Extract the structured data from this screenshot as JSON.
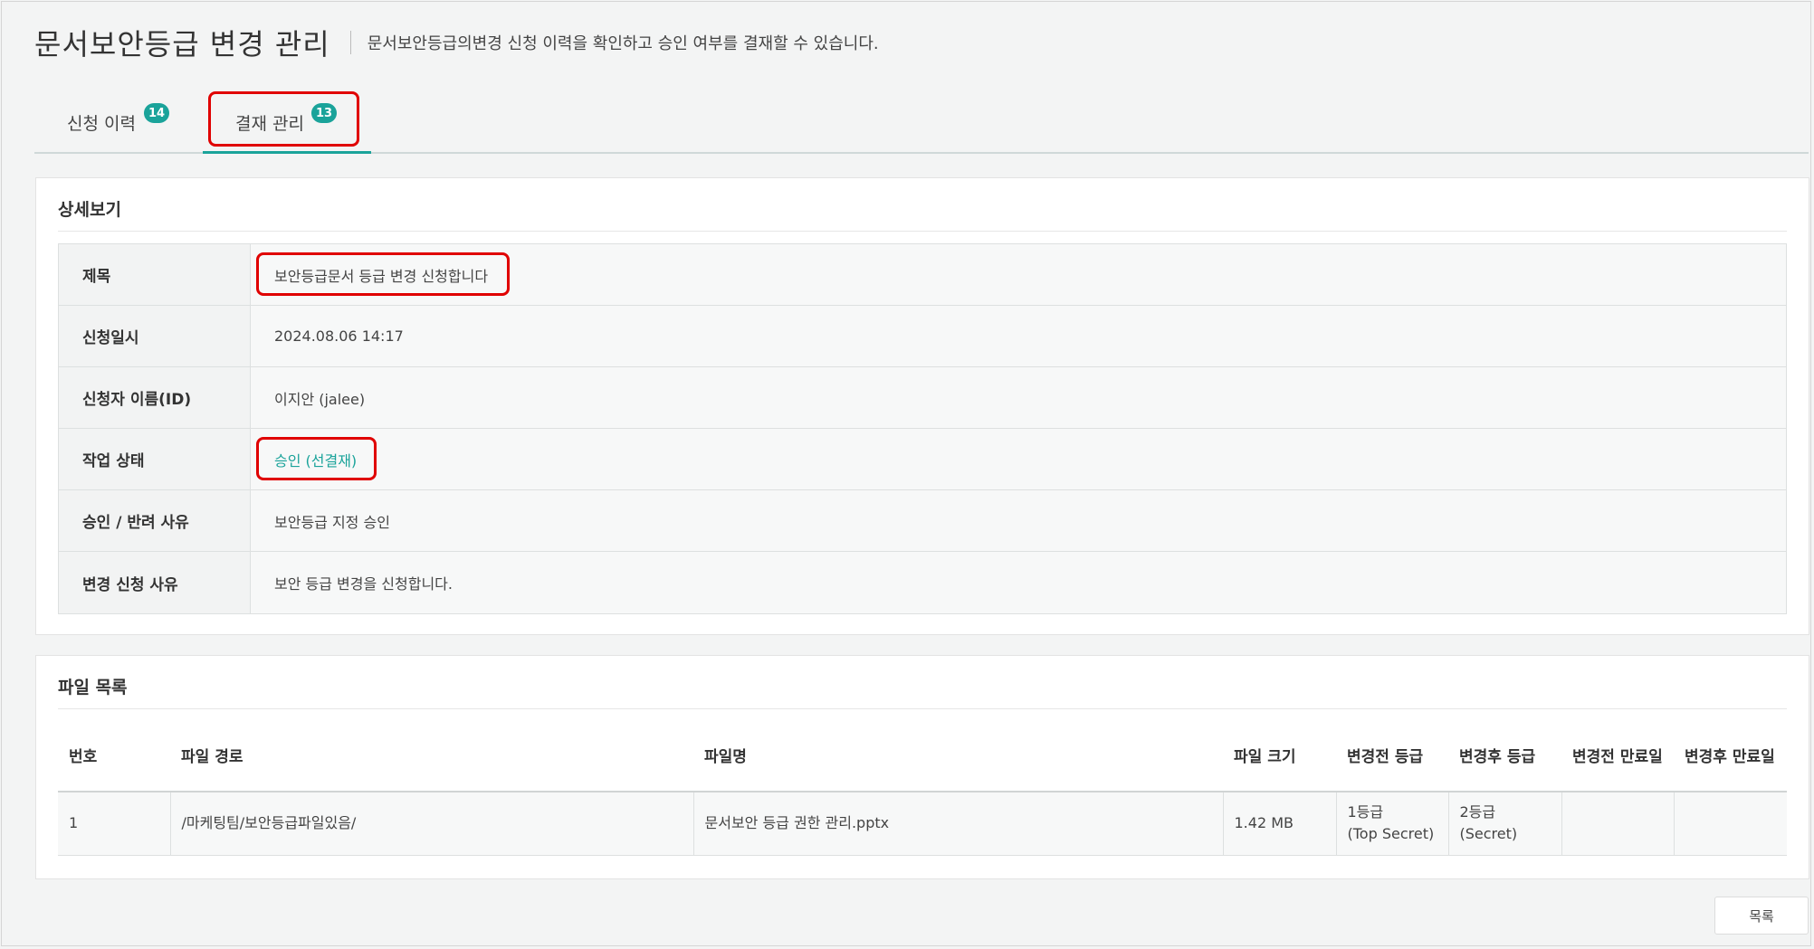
{
  "header": {
    "title": "문서보안등급 변경 관리",
    "description": "문서보안등급의변경 신청 이력을 확인하고 승인 여부를 결재할 수 있습니다."
  },
  "tabs": [
    {
      "label": "신청 이력",
      "count": "14",
      "active": false
    },
    {
      "label": "결재 관리",
      "count": "13",
      "active": true
    }
  ],
  "detail": {
    "heading": "상세보기",
    "rows": [
      {
        "key": "제목",
        "value": "보안등급문서 등급 변경 신청합니다"
      },
      {
        "key": "신청일시",
        "value": "2024.08.06 14:17"
      },
      {
        "key": "신청자 이름(ID)",
        "value": "이지안 (jalee)"
      },
      {
        "key": "작업 상태",
        "value": "승인 (선결재)"
      },
      {
        "key": "승인 / 반려 사유",
        "value": "보안등급 지정 승인"
      },
      {
        "key": "변경 신청 사유",
        "value": "보안 등급 변경을 신청합니다."
      }
    ]
  },
  "files": {
    "heading": "파일 목록",
    "columns": [
      "번호",
      "파일 경로",
      "파일명",
      "파일 크기",
      "변경전 등급",
      "변경후 등급",
      "변경전 만료일",
      "변경후 만료일"
    ],
    "rows": [
      {
        "no": "1",
        "path": "/마케팅팀/보안등급파일있음/",
        "name": "문서보안 등급 권한 관리.pptx",
        "size": "1.42 MB",
        "before_grade_1": "1등급",
        "before_grade_2": "(Top Secret)",
        "after_grade_1": "2등급",
        "after_grade_2": "(Secret)",
        "before_expiry": "",
        "after_expiry": ""
      }
    ]
  },
  "buttons": {
    "list": "목록"
  },
  "colors": {
    "accent": "#1aa39a",
    "highlight": "#e00000"
  }
}
